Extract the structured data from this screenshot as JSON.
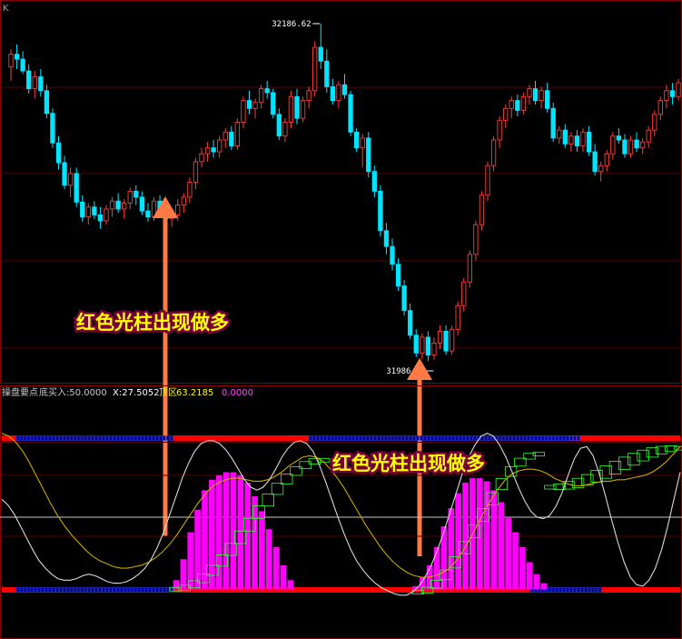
{
  "corner_label": "K",
  "chart_data": [
    {
      "type": "candlestick",
      "price_labels": {
        "high": "32186.62",
        "low": "31986.00"
      },
      "up_color": "#ff3c3c",
      "down_color": "#00e5ff",
      "candles": [
        [
          32142,
          32160,
          32128,
          32155
        ],
        [
          32155,
          32165,
          32140,
          32150
        ],
        [
          32150,
          32158,
          32135,
          32138
        ],
        [
          32138,
          32145,
          32115,
          32120
        ],
        [
          32120,
          32138,
          32110,
          32132
        ],
        [
          32132,
          32140,
          32112,
          32118
        ],
        [
          32118,
          32124,
          32090,
          32095
        ],
        [
          32095,
          32100,
          32060,
          32065
        ],
        [
          32065,
          32072,
          32038,
          32045
        ],
        [
          32045,
          32052,
          32018,
          32022
        ],
        [
          32022,
          32040,
          32010,
          32034
        ],
        [
          32034,
          32040,
          32000,
          32005
        ],
        [
          32005,
          32012,
          31985,
          31990
        ],
        [
          31990,
          32004,
          31982,
          32000
        ],
        [
          32000,
          32006,
          31988,
          31992
        ],
        [
          31992,
          32000,
          31978,
          31986
        ],
        [
          31986,
          32002,
          31982,
          31998
        ],
        [
          31998,
          32010,
          31990,
          32006
        ],
        [
          32006,
          32014,
          31994,
          31998
        ],
        [
          31998,
          32008,
          31988,
          32004
        ],
        [
          32004,
          32020,
          31998,
          32016
        ],
        [
          32016,
          32022,
          32002,
          32010
        ],
        [
          32010,
          32016,
          31992,
          31996
        ],
        [
          31996,
          32004,
          31985,
          31990
        ],
        [
          31990,
          32010,
          31986,
          32006
        ],
        [
          32006,
          32012,
          31990,
          31994
        ],
        [
          31994,
          32004,
          31982,
          31988
        ],
        [
          31988,
          31998,
          31980,
          31992
        ],
        [
          31992,
          32008,
          31986,
          32002
        ],
        [
          32002,
          32014,
          31994,
          32010
        ],
        [
          32010,
          32030,
          32004,
          32025
        ],
        [
          32025,
          32050,
          32018,
          32046
        ],
        [
          32046,
          32060,
          32040,
          32054
        ],
        [
          32054,
          32066,
          32046,
          32060
        ],
        [
          32060,
          32068,
          32050,
          32056
        ],
        [
          32056,
          32072,
          32050,
          32068
        ],
        [
          32068,
          32080,
          32060,
          32076
        ],
        [
          32076,
          32082,
          32058,
          32062
        ],
        [
          32062,
          32090,
          32058,
          32086
        ],
        [
          32086,
          32112,
          32080,
          32108
        ],
        [
          32108,
          32118,
          32094,
          32100
        ],
        [
          32100,
          32110,
          32090,
          32106
        ],
        [
          32106,
          32124,
          32100,
          32120
        ],
        [
          32120,
          32128,
          32110,
          32116
        ],
        [
          32116,
          32120,
          32090,
          32094
        ],
        [
          32094,
          32100,
          32068,
          32072
        ],
        [
          32072,
          32090,
          32066,
          32086
        ],
        [
          32086,
          32118,
          32080,
          32112
        ],
        [
          32112,
          32120,
          32084,
          32090
        ],
        [
          32090,
          32112,
          32086,
          32108
        ],
        [
          32108,
          32122,
          32100,
          32118
        ],
        [
          32118,
          32168,
          32112,
          32162
        ],
        [
          32162,
          32186,
          32140,
          32148
        ],
        [
          32148,
          32160,
          32116,
          32122
        ],
        [
          32122,
          32130,
          32104,
          32108
        ],
        [
          32108,
          32128,
          32100,
          32124
        ],
        [
          32124,
          32135,
          32110,
          32114
        ],
        [
          32114,
          32118,
          32072,
          32076
        ],
        [
          32076,
          32080,
          32056,
          32060
        ],
        [
          32060,
          32074,
          32040,
          32070
        ],
        [
          32070,
          32076,
          32030,
          32036
        ],
        [
          32036,
          32042,
          32010,
          32016
        ],
        [
          32016,
          32022,
          31970,
          31976
        ],
        [
          31976,
          31984,
          31952,
          31960
        ],
        [
          31960,
          31968,
          31936,
          31942
        ],
        [
          31942,
          31948,
          31915,
          31920
        ],
        [
          31920,
          31926,
          31890,
          31895
        ],
        [
          31895,
          31902,
          31866,
          31870
        ],
        [
          31870,
          31876,
          31848,
          31852
        ],
        [
          31852,
          31872,
          31846,
          31868
        ],
        [
          31868,
          31874,
          31844,
          31850
        ],
        [
          31850,
          31868,
          31845,
          31862
        ],
        [
          31862,
          31880,
          31856,
          31874
        ],
        [
          31874,
          31880,
          31850,
          31854
        ],
        [
          31854,
          31880,
          31850,
          31876
        ],
        [
          31876,
          31904,
          31870,
          31900
        ],
        [
          31900,
          31928,
          31894,
          31924
        ],
        [
          31924,
          31956,
          31918,
          31952
        ],
        [
          31952,
          31986,
          31946,
          31982
        ],
        [
          31982,
          32016,
          31976,
          32012
        ],
        [
          32012,
          32046,
          32006,
          32042
        ],
        [
          32042,
          32072,
          32036,
          32068
        ],
        [
          32068,
          32092,
          32060,
          32088
        ],
        [
          32088,
          32104,
          32080,
          32100
        ],
        [
          32100,
          32112,
          32090,
          32108
        ],
        [
          32108,
          32114,
          32092,
          32098
        ],
        [
          32098,
          32116,
          32094,
          32112
        ],
        [
          32112,
          32124,
          32104,
          32120
        ],
        [
          32120,
          32128,
          32104,
          32108
        ],
        [
          32108,
          32122,
          32100,
          32118
        ],
        [
          32118,
          32126,
          32096,
          32100
        ],
        [
          32100,
          32106,
          32066,
          32070
        ],
        [
          32070,
          32082,
          32064,
          32078
        ],
        [
          32078,
          32084,
          32060,
          32064
        ],
        [
          32064,
          32076,
          32056,
          32072
        ],
        [
          32072,
          32078,
          32056,
          32062
        ],
        [
          32062,
          32080,
          32056,
          32076
        ],
        [
          32076,
          32082,
          32052,
          32056
        ],
        [
          32056,
          32064,
          32032,
          32036
        ],
        [
          32036,
          32046,
          32026,
          32042
        ],
        [
          32042,
          32058,
          32036,
          32054
        ],
        [
          32054,
          32076,
          32048,
          32072
        ],
        [
          32072,
          32080,
          32064,
          32068
        ],
        [
          32068,
          32074,
          32050,
          32054
        ],
        [
          32054,
          32072,
          32050,
          32068
        ],
        [
          32068,
          32076,
          32056,
          32060
        ],
        [
          32060,
          32070,
          32054,
          32066
        ],
        [
          32066,
          32082,
          32060,
          32078
        ],
        [
          32078,
          32098,
          32072,
          32094
        ],
        [
          32094,
          32112,
          32088,
          32108
        ],
        [
          32108,
          32124,
          32100,
          32118
        ],
        [
          32118,
          32126,
          32104,
          32112
        ],
        [
          32112,
          32130,
          32108,
          32126
        ]
      ],
      "annotation": "红色光柱出现做多"
    },
    {
      "type": "indicator",
      "header": {
        "name": "操盘要点",
        "buy_label": "底买入:50.0000",
        "x_label": "X:27.5052",
        "top_label": "顶区",
        "top_value": "63.2185",
        "last_value": "0.0000"
      },
      "y_range": [
        -10,
        110
      ],
      "levels": [
        100,
        50,
        0
      ],
      "white_line": [
        62,
        58,
        52,
        44,
        36,
        28,
        21,
        16,
        12,
        9,
        8,
        8,
        9,
        11,
        12,
        11,
        9,
        7,
        6,
        6,
        7,
        9,
        12,
        16,
        22,
        30,
        40,
        52,
        64,
        76,
        86,
        94,
        99,
        101,
        101,
        99,
        95,
        89,
        82,
        75,
        70,
        68,
        70,
        75,
        82,
        90,
        96,
        100,
        101,
        99,
        94,
        85,
        74,
        62,
        50,
        39,
        29,
        21,
        15,
        10,
        6,
        3,
        1,
        -1,
        -2,
        -2,
        0,
        4,
        10,
        18,
        28,
        40,
        53,
        66,
        79,
        90,
        98,
        104,
        106,
        104,
        98,
        90,
        80,
        70,
        61,
        54,
        50,
        49,
        51,
        57,
        66,
        78,
        89,
        96,
        97,
        91,
        79,
        64,
        48,
        33,
        20,
        10,
        5,
        4,
        8,
        16,
        28,
        44,
        62,
        80
      ],
      "yellow_line": [
        106,
        104,
        100,
        94,
        86,
        77,
        68,
        59,
        51,
        44,
        38,
        33,
        28,
        24,
        21,
        19,
        17,
        16,
        16,
        17,
        18,
        20,
        23,
        27,
        32,
        38,
        45,
        52,
        59,
        65,
        70,
        73,
        75,
        76,
        76,
        75,
        74,
        74,
        75,
        77,
        80,
        84,
        87,
        90,
        91,
        90,
        87,
        82,
        76,
        69,
        61,
        53,
        45,
        38,
        31,
        25,
        20,
        16,
        13,
        11,
        10,
        10,
        11,
        13,
        16,
        21,
        28,
        36,
        45,
        54,
        62,
        69,
        75,
        79,
        81,
        82,
        82,
        81,
        79,
        76,
        74,
        72,
        71,
        71,
        72,
        73,
        74,
        74,
        75,
        75,
        76,
        77,
        78,
        80,
        83,
        87,
        92,
        97
      ],
      "magenta_bars": [
        {
          "start": 48,
          "values": [
            8,
            22,
            40,
            55,
            68,
            75,
            78,
            80,
            80,
            78,
            73,
            64,
            54,
            42,
            30,
            18,
            8
          ]
        },
        {
          "start": 115,
          "values": [
            4,
            10,
            18,
            30,
            44,
            56,
            66,
            73,
            76,
            76,
            74,
            68,
            60,
            50,
            40,
            30,
            20,
            12,
            6
          ]
        }
      ],
      "band_top": {
        "red": [
          [
            0,
            4
          ],
          [
            48,
            86
          ],
          [
            159,
            178
          ],
          [
            162,
            190
          ]
        ],
        "blue": [
          [
            4,
            48
          ],
          [
            86,
            159
          ],
          [
            148,
            162
          ]
        ]
      },
      "band_bottom": {
        "red": [
          [
            0,
            4
          ],
          [
            48,
            148
          ],
          [
            168,
            190
          ]
        ],
        "blue": [
          [
            4,
            48
          ],
          [
            148,
            168
          ]
        ]
      },
      "green_boxes": [
        {
          "start": 47,
          "end": 90,
          "from": 2,
          "to": 88
        },
        {
          "start": 115,
          "end": 152,
          "from": 0,
          "to": 92
        },
        {
          "start": 152,
          "end": 190,
          "from": 70,
          "to": 96
        }
      ],
      "annotation": "红色光柱出现做多"
    }
  ]
}
